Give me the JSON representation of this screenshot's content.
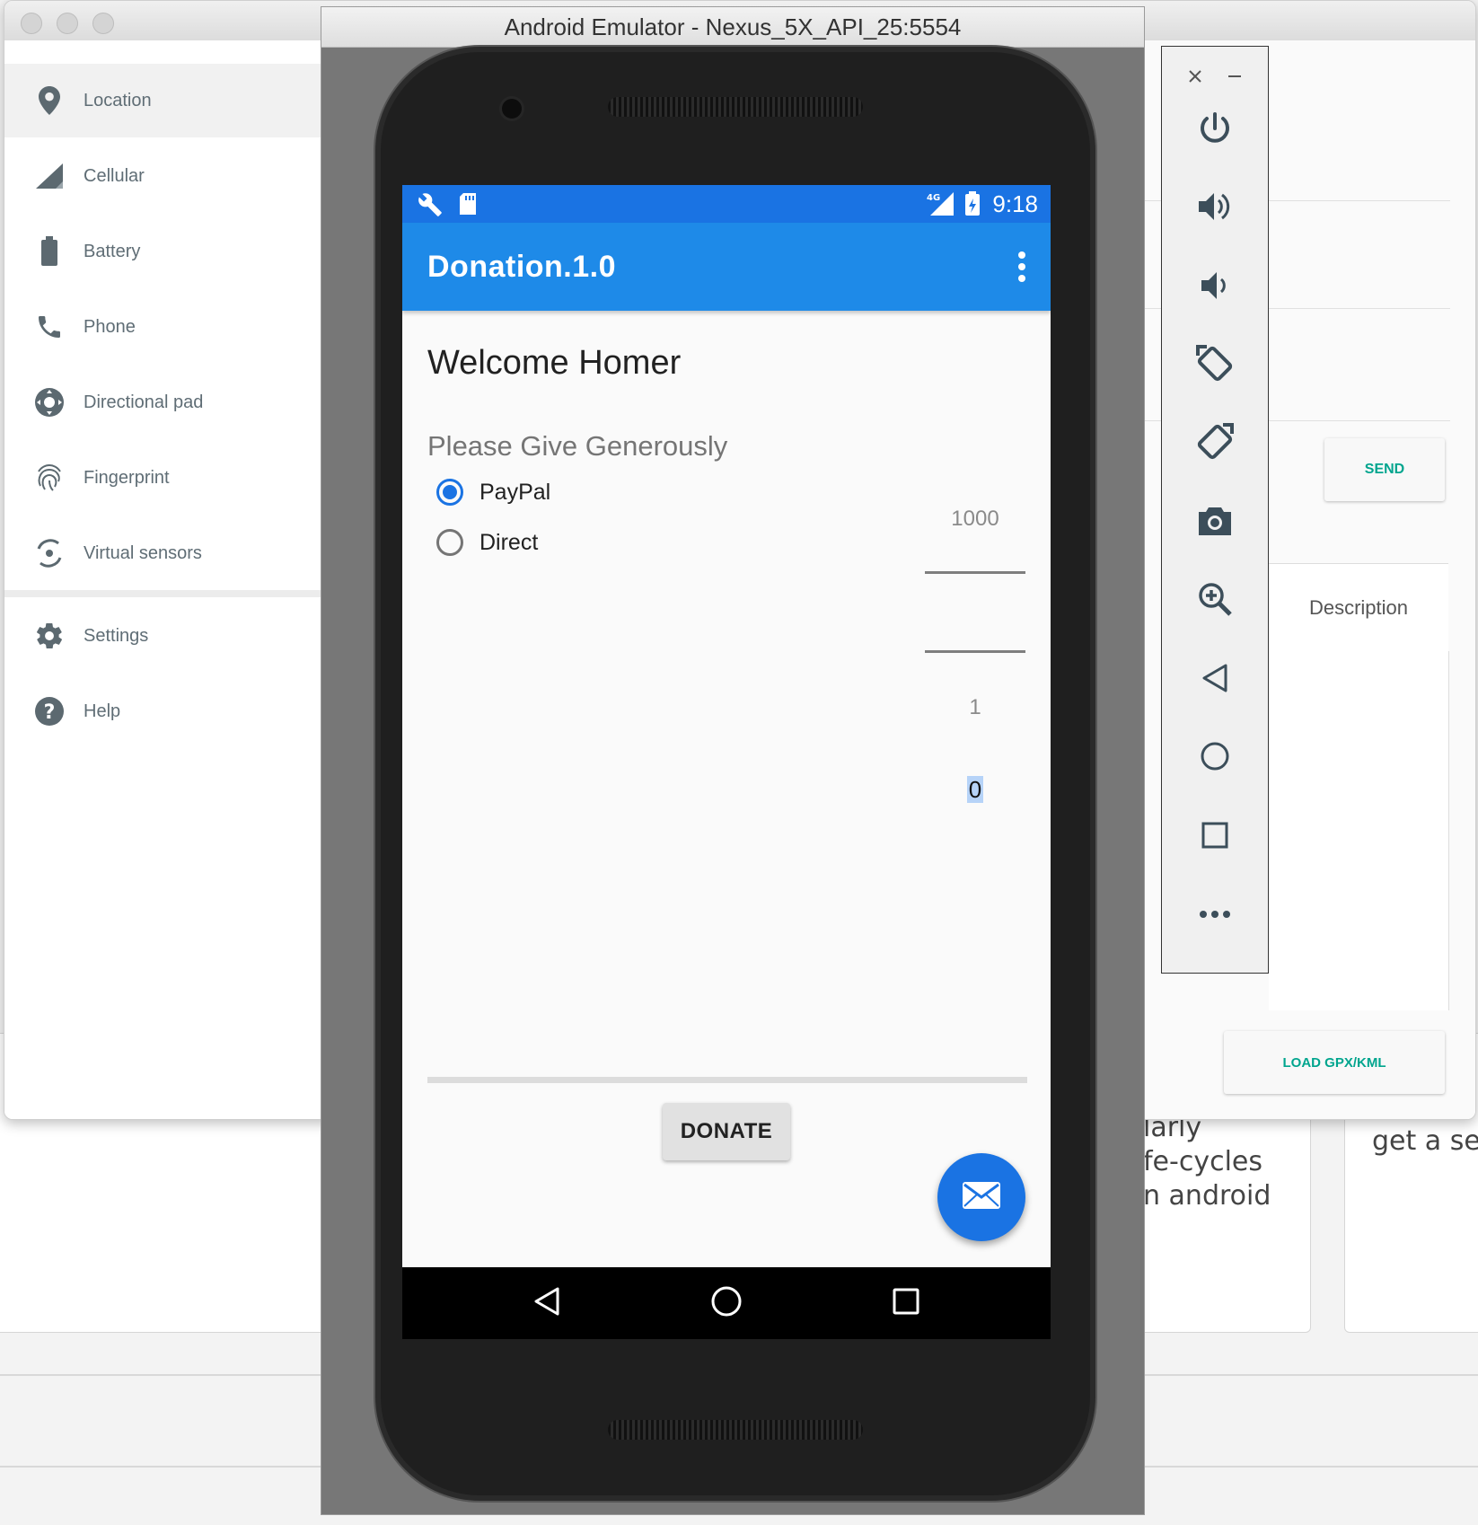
{
  "emulator": {
    "title": "Android Emulator - Nexus_5X_API_25:5554"
  },
  "extended_controls": {
    "sidebar": {
      "items": [
        {
          "label": "Location",
          "icon": "location-pin-icon"
        },
        {
          "label": "Cellular",
          "icon": "signal-icon"
        },
        {
          "label": "Battery",
          "icon": "battery-icon"
        },
        {
          "label": "Phone",
          "icon": "phone-icon"
        },
        {
          "label": "Directional pad",
          "icon": "dpad-icon"
        },
        {
          "label": "Fingerprint",
          "icon": "fingerprint-icon"
        },
        {
          "label": "Virtual sensors",
          "icon": "rotation-icon"
        },
        {
          "label": "Settings",
          "icon": "gear-icon"
        },
        {
          "label": "Help",
          "icon": "help-icon"
        }
      ],
      "active": "Location"
    },
    "send_label": "SEND",
    "description_header": "Description",
    "load_label": "LOAD GPX/KML"
  },
  "app": {
    "status_bar": {
      "time": "9:18",
      "network": "4G"
    },
    "title": "Donation.1.0",
    "welcome": "Welcome Homer",
    "prompt": "Please Give Generously",
    "payment_options": [
      {
        "label": "PayPal",
        "checked": true
      },
      {
        "label": "Direct",
        "checked": false
      }
    ],
    "picker": {
      "above": "1000",
      "current": "0",
      "below": "1"
    },
    "donate_label": "DONATE"
  },
  "background_page": {
    "card_text_1": [
      "larly",
      "fe-cycles",
      "n android"
    ],
    "card_text_2": "get a sen"
  },
  "colors": {
    "primary_dark": "#1a73e3",
    "primary": "#1e8ae8",
    "accent_teal": "#00a58e"
  }
}
